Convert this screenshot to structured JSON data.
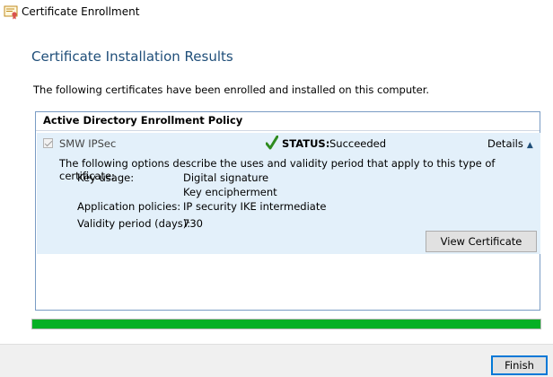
{
  "window": {
    "title": "Certificate Enrollment",
    "icon": "certificate-icon"
  },
  "page": {
    "heading": "Certificate Installation Results",
    "intro": "The following certificates have been enrolled and installed on this computer."
  },
  "policy": {
    "header": "Active Directory Enrollment Policy",
    "certificate": {
      "name": "SMW IPSec",
      "checked": true,
      "status_label": "STATUS:",
      "status_value": "Succeeded",
      "status_icon": "checkmark-icon",
      "details_label": "Details",
      "details_icon": "chevron-up-icon",
      "description": "The following options describe the uses and validity period that apply to this type of certificate:",
      "key_usage_label": "Key usage:",
      "key_usage_values": [
        "Digital signature",
        "Key encipherment"
      ],
      "app_policies_label": "Application policies:",
      "app_policies_value": "IP security IKE intermediate",
      "validity_label": "Validity period (days):",
      "validity_value": "730",
      "view_button": "View Certificate"
    }
  },
  "progress": {
    "value": 1.0,
    "color": "#06b025"
  },
  "footer": {
    "finish_button": "Finish"
  },
  "colors": {
    "heading": "#1f4e79",
    "panel_background": "#e3f0fa",
    "accent": "#0078d7"
  }
}
